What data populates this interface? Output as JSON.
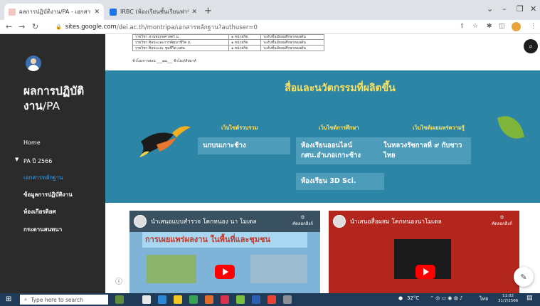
{
  "browser": {
    "tabs": [
      {
        "title": "ผลการปฏิบัติงาน/PA - เอกสารหลักฐ",
        "active": true
      },
      {
        "title": "IRBC (ห้องเรียนชั้นเรียนฟาร์มสา",
        "active": false
      }
    ],
    "new_tab": "+",
    "window_controls": [
      "⌄",
      "–",
      "❐",
      "✕"
    ],
    "address": {
      "host": "sites.google.com",
      "path": "/dei.ac.th/montripa/เอกสารหลักฐาน?authuser=0"
    }
  },
  "sidebar": {
    "title": "ผลการปฏิบัติ",
    "title2": "งาน",
    "title_pa": "/PA",
    "nav": {
      "home": "Home",
      "pa": "PA ปี 2566",
      "evidence": "เอกสารหลักฐาน",
      "performance": "ข้อมูลการปฏิบัติงาน",
      "honors": "ห้องเกียรติยศ",
      "board": "กระดานสนทนา"
    }
  },
  "doc": {
    "rows": [
      {
        "c1": "รายวิชา สวนพฤกษศาสตร์ ม.",
        "c2": "๑ หน่วยกิต",
        "c3": "ระดับชั้นมัธยมศึกษาตอนต้น"
      },
      {
        "c1": "รายวิชา ศิลปะและการพัฒนาชีวิต ม.",
        "c2": "๑ หน่วยกิต",
        "c3": "ระดับชั้นมัธยมศึกษาตอนต้น"
      },
      {
        "c1": "รายวิชา ศิลปะและ ชุมชีวิต ๓ศน.",
        "c2": "๑ หน่วยกิต",
        "c3": "ระดับชั้นมัธยมศึกษาตอนต้น"
      }
    ],
    "note": "ชั่วโมงการสอน ___๑๘___ ชั่วโมง/สัปดาห์"
  },
  "banner": {
    "title": "สื่อและนวัตกรรมที่ผลิตขึ้น",
    "col1_head": "เว็บไซต์รวบรวม",
    "col2_head": "เว็บไซต์การศึกษา",
    "col3_head": "เว็บไซต์เผยแพร่ความรู้",
    "links": {
      "hornbill": "นกบนเกาะช้าง",
      "online": "ห้องเรียนออนไลน์ กศน.อำเภอเกาะช้าง",
      "sci3d": "ห้องเรียน 3D Sci.",
      "king": "ในหลวงรัชกาลที่ ๙ กับชาวไทย"
    }
  },
  "videos": [
    {
      "title": "นำเสนอแบบสำรวจ โคกหนอง นา โมเดล",
      "copy": "คัดลอกลิงก์",
      "caption": "การเผยแพร่ผลงาน ในพื้นที่และชุมชน"
    },
    {
      "title": "นำเสนอสื่อผสม โคกหนองนาโมเดล",
      "copy": "คัดลอกลิงก์"
    }
  ],
  "taskbar": {
    "search_placeholder": "Type here to search",
    "weather": "32°C",
    "lang": "ไทย",
    "time": "11:02",
    "date": "31/7/2566"
  },
  "colors": {
    "sidebar": "#2b2b2b",
    "banner": "#2d85a5",
    "accent_yellow": "#ffe15a",
    "active_nav": "#2aa6ff"
  }
}
